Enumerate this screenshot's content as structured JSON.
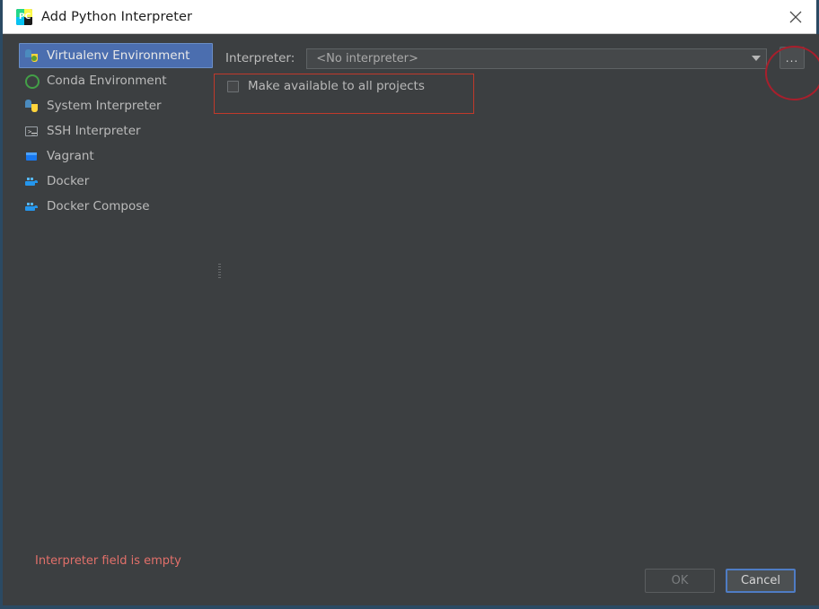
{
  "window": {
    "title": "Add Python Interpreter",
    "app_icon": "pycharm-icon",
    "close_label": "✕",
    "border_color": "#2b4a63"
  },
  "sidebar": {
    "items": [
      {
        "label": "Virtualenv Environment",
        "icon": "python-virtualenv-icon",
        "selected": true
      },
      {
        "label": "Conda Environment",
        "icon": "conda-ring-icon",
        "selected": false
      },
      {
        "label": "System Interpreter",
        "icon": "python-icon",
        "selected": false
      },
      {
        "label": "SSH Interpreter",
        "icon": "terminal-icon",
        "selected": false
      },
      {
        "label": "Vagrant",
        "icon": "vagrant-icon",
        "selected": false
      },
      {
        "label": "Docker",
        "icon": "docker-whale-icon",
        "selected": false
      },
      {
        "label": "Docker Compose",
        "icon": "docker-whale-icon",
        "selected": false
      }
    ],
    "selected_color": "#4b6eaf"
  },
  "main": {
    "interpreter_label": "Interpreter:",
    "interpreter_value": "<No interpreter>",
    "interpreter_dropdown_icon": "chevron-down-icon",
    "browse_button_label": "...",
    "checkbox_label": "Make available to all projects",
    "checkbox_checked": false
  },
  "annotations": {
    "ellipse_color": "#a81f2c",
    "rect_color": "#c0392b"
  },
  "status": {
    "error_message": "Interpreter field is empty",
    "error_color": "#e2706a"
  },
  "footer": {
    "ok_label": "OK",
    "cancel_label": "Cancel",
    "ok_enabled": false,
    "cancel_focused": true
  }
}
